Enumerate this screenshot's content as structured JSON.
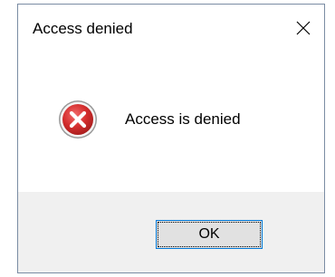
{
  "dialog": {
    "title": "Access denied",
    "message": "Access is denied",
    "ok_label": "OK"
  },
  "icons": {
    "close": "close-icon",
    "status": "error-icon"
  },
  "colors": {
    "error_red": "#d42e2e",
    "button_focus_border": "#0078d7",
    "footer_bg": "#f0f0f0",
    "button_bg": "#e1e1e1"
  }
}
